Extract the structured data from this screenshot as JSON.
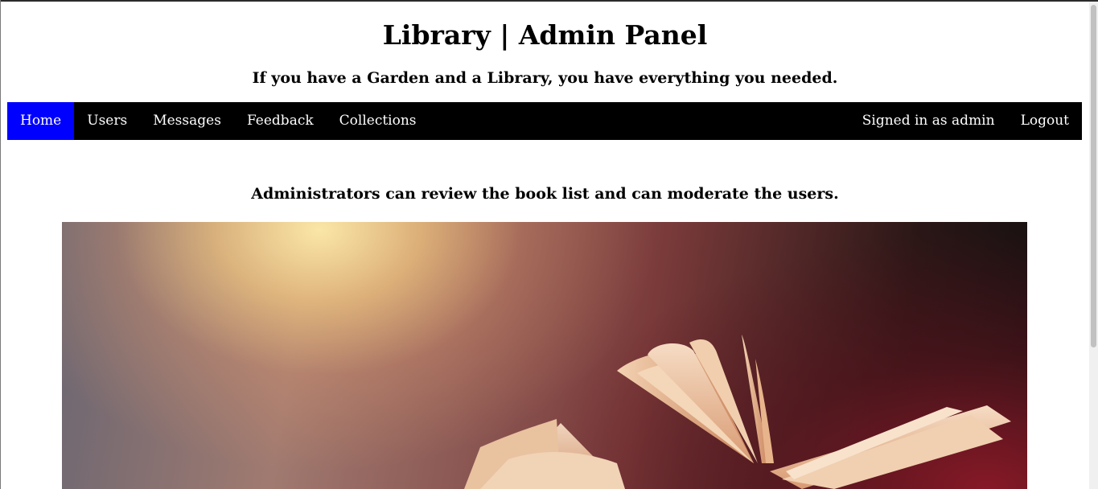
{
  "header": {
    "title": "Library | Admin Panel",
    "tagline": "If you have a Garden and a Library, you have everything you needed."
  },
  "nav": {
    "left": [
      {
        "label": "Home",
        "active": true
      },
      {
        "label": "Users"
      },
      {
        "label": "Messages"
      },
      {
        "label": "Feedback"
      },
      {
        "label": "Collections"
      }
    ],
    "signed_in": "Signed in as admin",
    "logout": "Logout"
  },
  "main": {
    "intro": "Administrators can review the book list and can moderate the users.",
    "hero_image": "open-book-photo"
  },
  "colors": {
    "navbar_bg": "#000000",
    "active_nav_bg": "#0000ff",
    "nav_text": "#ffffff"
  }
}
